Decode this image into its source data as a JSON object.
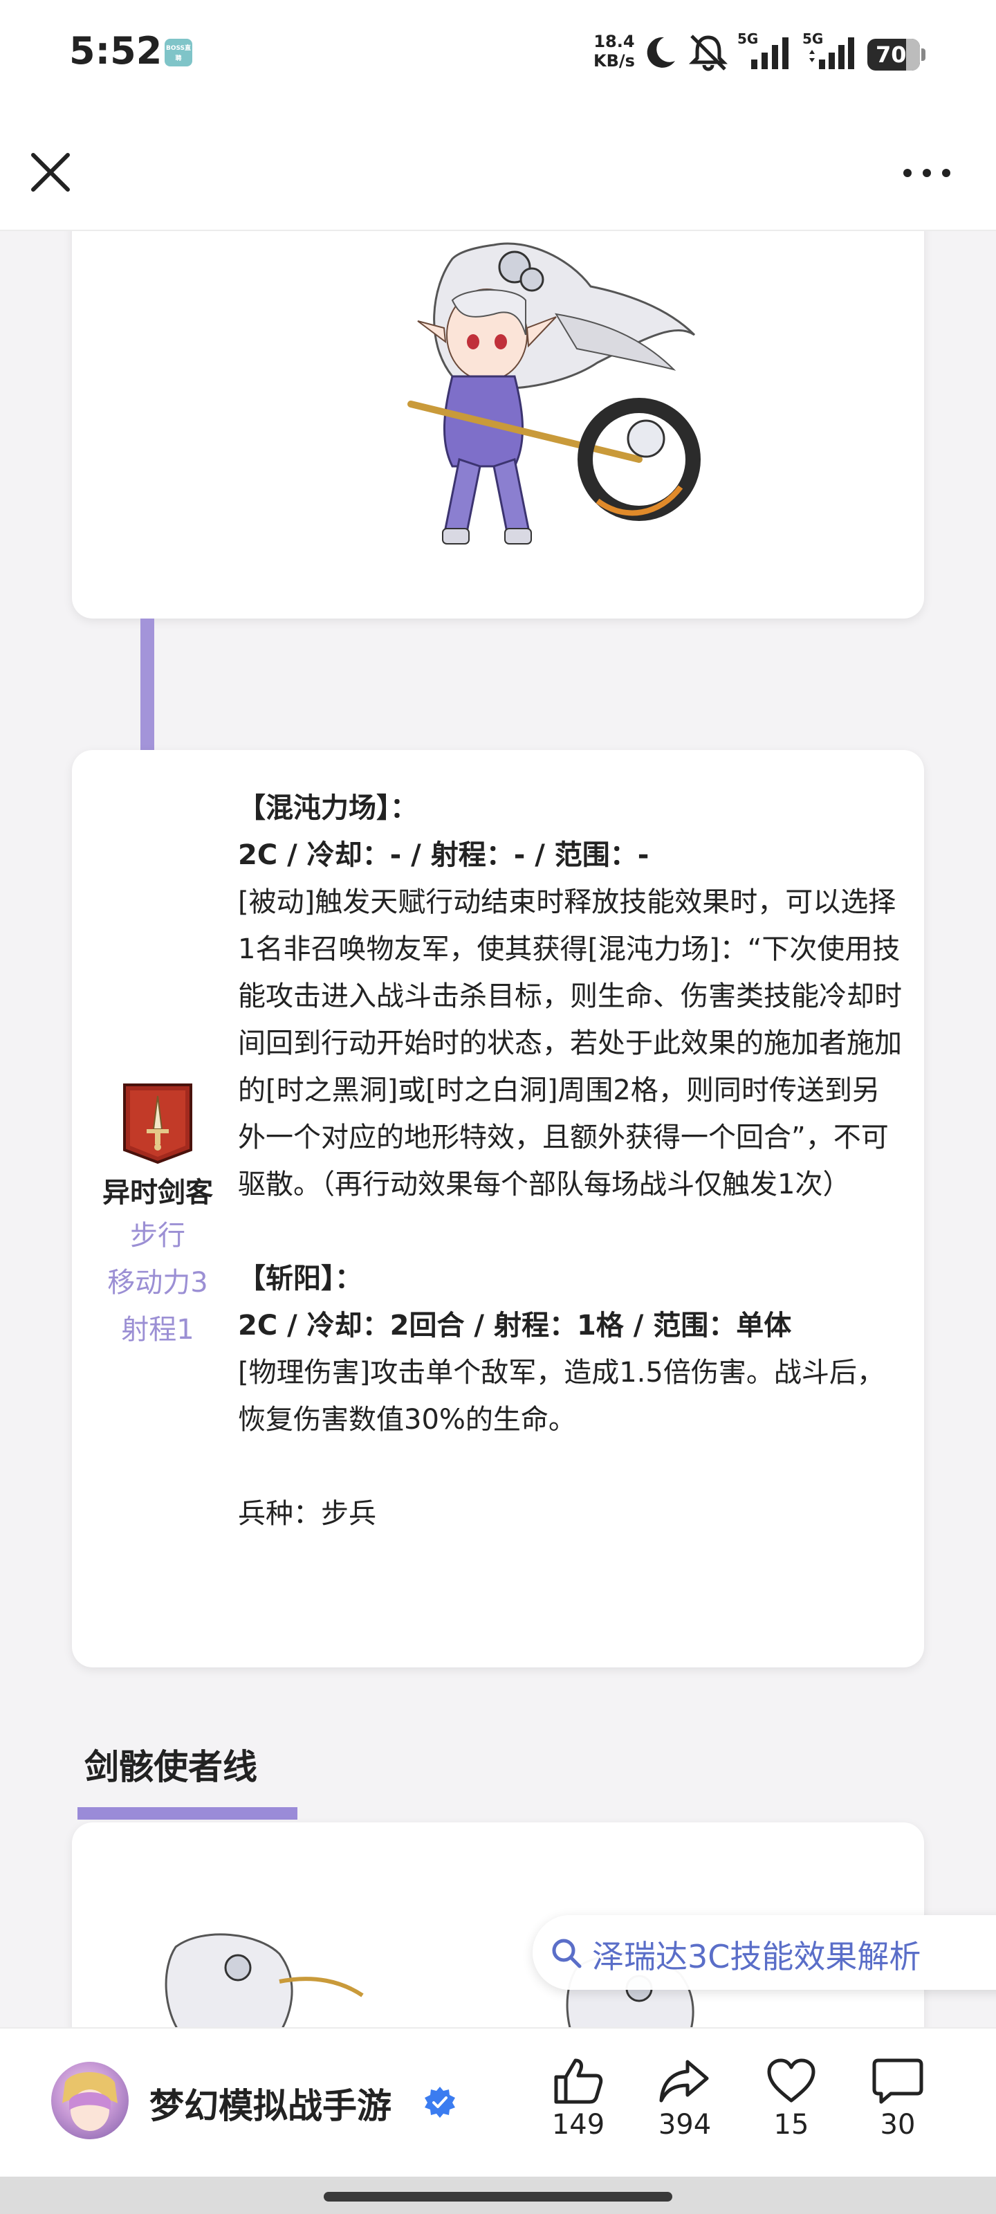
{
  "status_bar": {
    "time": "5:52",
    "app_badge": "BOSS直聘",
    "net_speed_value": "18.4",
    "net_speed_unit": "KB/s",
    "signal1_label": "5G",
    "signal2_label": "5G",
    "battery": "70"
  },
  "unit": {
    "name": "异时剑客",
    "move_type": "步行",
    "move_power": "移动力3",
    "range": "射程1"
  },
  "skills": [
    {
      "title": "【混沌力场】：",
      "stats": "2C / 冷却：- / 射程：- / 范围：-",
      "desc": "[被动]触发天赋行动结束时释放技能效果时，可以选择1名非召唤物友军，使其获得[混沌力场]：“下次使用技能攻击进入战斗击杀目标，则生命、伤害类技能冷却时间回到行动开始时的状态，若处于此效果的施加者施加的[时之黑洞]或[时之白洞]周围2格，则同时传送到另外一个对应的地形特效，且额外获得一个回合”，不可驱散。（再行动效果每个部队每场战斗仅触发1次）"
    },
    {
      "title": "【斩阳】：",
      "stats": "2C / 冷却：2回合 / 射程：1格 / 范围：单体",
      "desc": "[物理伤害]攻击单个敌军，造成1.5倍伤害。战斗后，恢复伤害数值30%的生命。"
    }
  ],
  "troop_type": "兵种：步兵",
  "section": {
    "title": "剑骸使者线"
  },
  "search_chip": {
    "text": "泽瑞达3C技能效果解析"
  },
  "bottom_bar": {
    "author": "梦幻模拟战手游",
    "likes": "149",
    "shares": "394",
    "favorites": "15",
    "comments": "30"
  },
  "colors": {
    "accent_purple": "#9a8bd8",
    "search_blue": "#5a6ec8",
    "verify_blue": "#3b7cf0"
  }
}
